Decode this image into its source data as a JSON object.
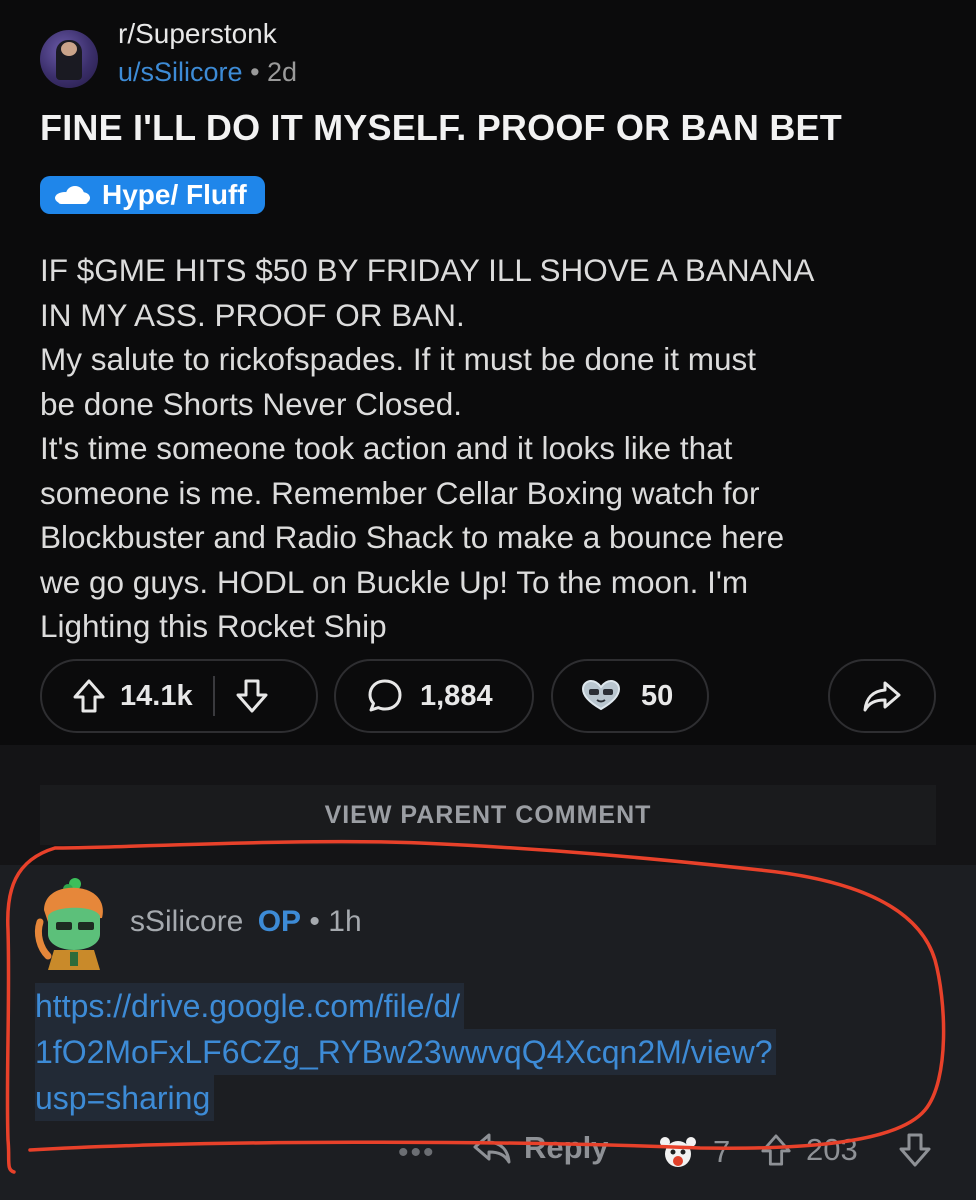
{
  "post": {
    "subreddit": "r/Superstonk",
    "author": "u/sSilicore",
    "separator": "•",
    "age": "2d",
    "title": "FINE I'LL DO IT MYSELF. PROOF OR BAN BET",
    "flair": "Hype/ Fluff",
    "body_lines": [
      "IF $GME HITS $50 BY FRIDAY ILL SHOVE A BANANA",
      "IN MY ASS. PROOF OR BAN.",
      "My salute to rickofspades. If it must be done it must",
      "be done Shorts Never Closed.",
      "It's time someone took action and it looks like that",
      "someone is me. Remember Cellar Boxing watch for",
      "Blockbuster and Radio Shack to make a bounce here",
      "we go guys. HODL on Buckle Up! To the moon. I'm",
      "Lighting this Rocket Ship"
    ],
    "upvotes": "14.1k",
    "comments": "1,884",
    "awards": "50"
  },
  "view_parent": "VIEW PARENT COMMENT",
  "comment": {
    "author": "sSilicore",
    "op_badge": "OP",
    "separator": "•",
    "age": "1h",
    "link_lines": [
      "https://drive.google.com/file/d/",
      "1fO2MoFxLF6CZg_RYBw23wwvqQ4Xcqn2M/view?",
      "usp=sharing"
    ],
    "more": "•••",
    "reply_label": "Reply",
    "award_count": "7",
    "score": "203"
  },
  "colors": {
    "background": "#0b0b0c",
    "comment_background": "#1c1e22",
    "link": "#3d8bd6",
    "flair": "#1f86ea",
    "annotation": "#e8412a"
  },
  "icons": [
    "upvote-icon",
    "downvote-icon",
    "comment-bubble-icon",
    "award-icon",
    "share-icon",
    "reply-icon",
    "cloud-icon"
  ]
}
